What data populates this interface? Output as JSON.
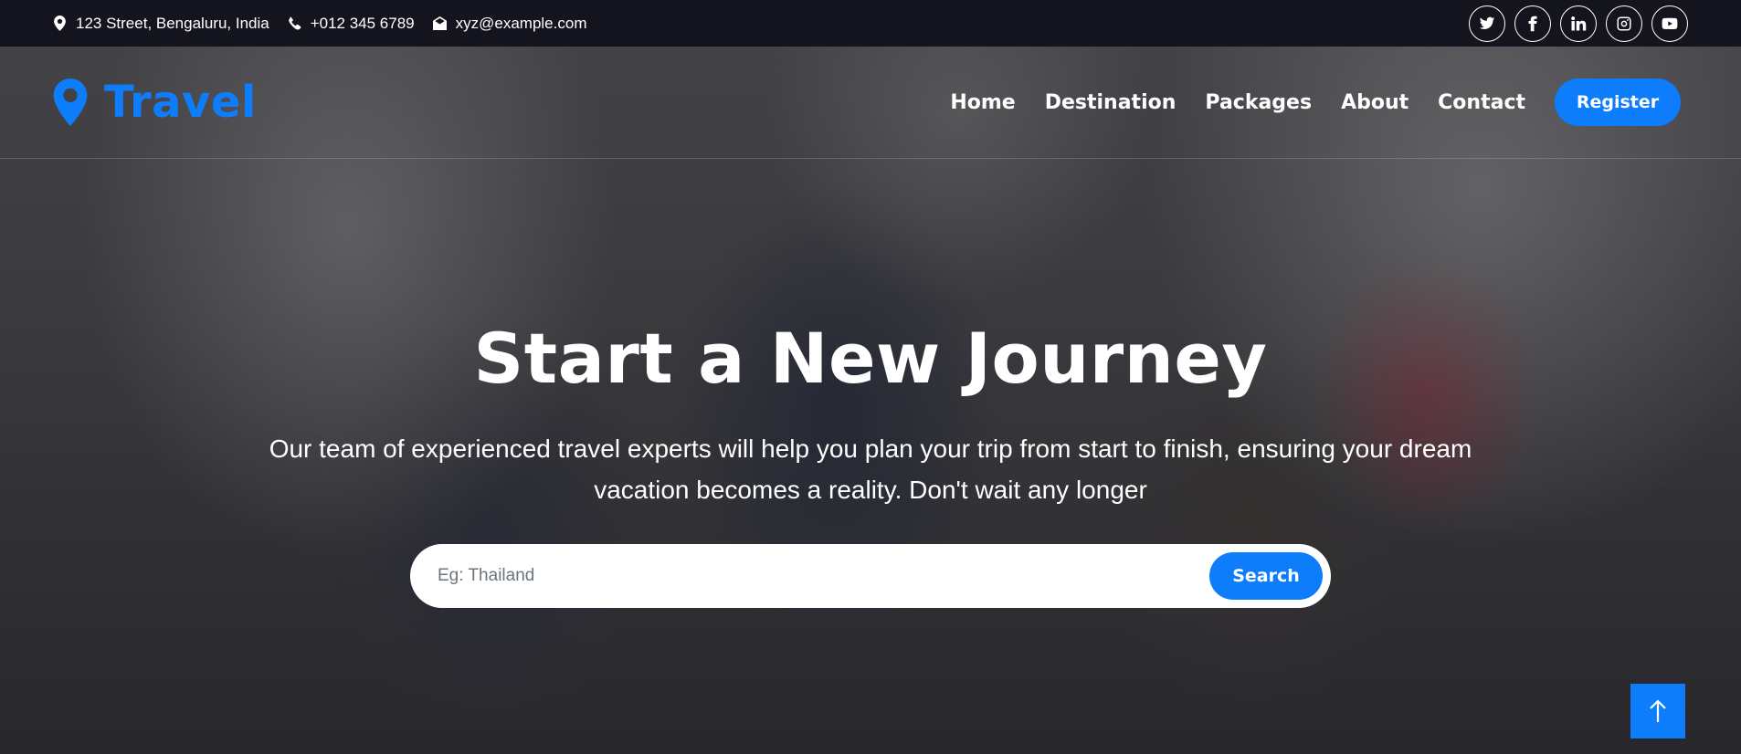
{
  "topbar": {
    "address": "123 Street, Bengaluru, India",
    "phone": "+012 345 6789",
    "email": "xyz@example.com",
    "socials": [
      "twitter-icon",
      "facebook-icon",
      "linkedin-icon",
      "instagram-icon",
      "youtube-icon"
    ]
  },
  "navbar": {
    "brand": "Travel",
    "links": [
      "Home",
      "Destination",
      "Packages",
      "About",
      "Contact"
    ],
    "register": "Register"
  },
  "hero": {
    "title": "Start a New Journey",
    "text": "Our team of experienced travel experts will help you plan your trip from start to finish, ensuring your dream vacation becomes a reality. Don't wait any longer",
    "search_placeholder": "Eg: Thailand",
    "search_value": "",
    "search_button": "Search"
  },
  "colors": {
    "primary": "#0d7dfc",
    "topbar_bg": "#14141f",
    "text": "#ffffff"
  }
}
